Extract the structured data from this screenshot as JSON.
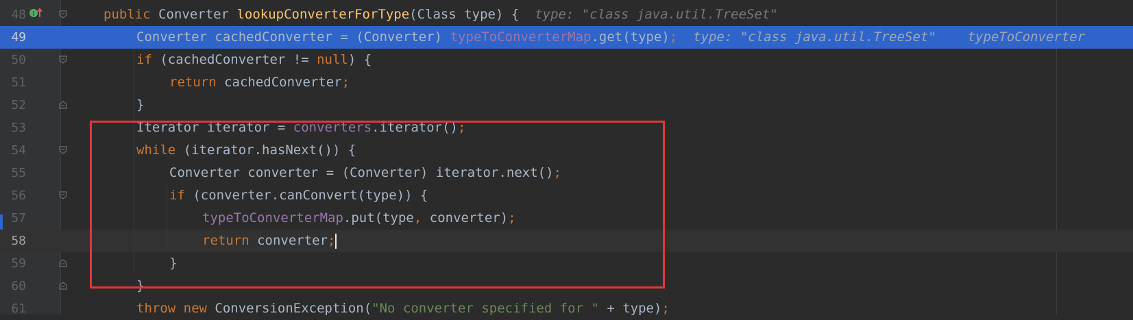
{
  "editor": {
    "lines": [
      {
        "num": "48",
        "tokens": [
          [
            "kw",
            "public"
          ],
          [
            "p",
            " Converter "
          ],
          [
            "fn",
            "lookupConverterForType"
          ],
          [
            "p",
            "(Class type) {  "
          ],
          [
            "hint",
            "type: "
          ],
          [
            "hintstr",
            "\"class java.util.TreeSet\""
          ]
        ]
      },
      {
        "num": "49",
        "tokens": [
          [
            "p",
            "Converter cachedConverter = (Converter) "
          ],
          [
            "fld",
            "typeToConverterMap"
          ],
          [
            "p",
            ".get(type)"
          ],
          [
            "kw",
            ";"
          ],
          [
            "p",
            "  "
          ],
          [
            "hint",
            "type: "
          ],
          [
            "hintstr",
            "\"class java.util.TreeSet\""
          ],
          [
            "p",
            "    "
          ],
          [
            "hint",
            "typeToConverter"
          ]
        ]
      },
      {
        "num": "50",
        "tokens": [
          [
            "kw",
            "if"
          ],
          [
            "p",
            " (cachedConverter != "
          ],
          [
            "kw",
            "null"
          ],
          [
            "p",
            ") {"
          ]
        ]
      },
      {
        "num": "51",
        "tokens": [
          [
            "kw",
            "return"
          ],
          [
            "p",
            " cachedConverter"
          ],
          [
            "kw",
            ";"
          ]
        ]
      },
      {
        "num": "52",
        "tokens": [
          [
            "p",
            "}"
          ]
        ]
      },
      {
        "num": "53",
        "tokens": [
          [
            "p",
            "Iterator iterator = "
          ],
          [
            "fld",
            "converters"
          ],
          [
            "p",
            ".iterator()"
          ],
          [
            "kw",
            ";"
          ]
        ]
      },
      {
        "num": "54",
        "tokens": [
          [
            "kw",
            "while"
          ],
          [
            "p",
            " (iterator.hasNext()) {"
          ]
        ]
      },
      {
        "num": "55",
        "tokens": [
          [
            "p",
            "Converter converter = (Converter) iterator.next()"
          ],
          [
            "kw",
            ";"
          ]
        ]
      },
      {
        "num": "56",
        "tokens": [
          [
            "kw",
            "if"
          ],
          [
            "p",
            " (converter.canConvert(type)) {"
          ]
        ]
      },
      {
        "num": "57",
        "tokens": [
          [
            "fld",
            "typeToConverterMap"
          ],
          [
            "p",
            ".put(type"
          ],
          [
            "kw",
            ","
          ],
          [
            "p",
            " converter)"
          ],
          [
            "kw",
            ";"
          ]
        ]
      },
      {
        "num": "58",
        "tokens": [
          [
            "kw",
            "return"
          ],
          [
            "p",
            " converter"
          ],
          [
            "kw",
            ";"
          ]
        ]
      },
      {
        "num": "59",
        "tokens": [
          [
            "p",
            "}"
          ]
        ]
      },
      {
        "num": "60",
        "tokens": [
          [
            "p",
            "}"
          ]
        ]
      },
      {
        "num": "61",
        "tokens": [
          [
            "kw",
            "throw new"
          ],
          [
            "p",
            " ConversionException("
          ],
          [
            "str",
            "\"No converter specified for \""
          ],
          [
            "p",
            " + type)"
          ],
          [
            "kw",
            ";"
          ]
        ]
      }
    ],
    "selected_line": "49",
    "caret_line": "58"
  },
  "icons": {
    "override": "override-method-icon",
    "fold": "fold-marker-icon"
  },
  "colors": {
    "background": "#2b2b2b",
    "selection": "#2f65ca",
    "keyword": "#cc7832",
    "method": "#ffc66d",
    "field": "#9876aa",
    "string": "#6a8759",
    "highlight_box": "#e0383c"
  }
}
